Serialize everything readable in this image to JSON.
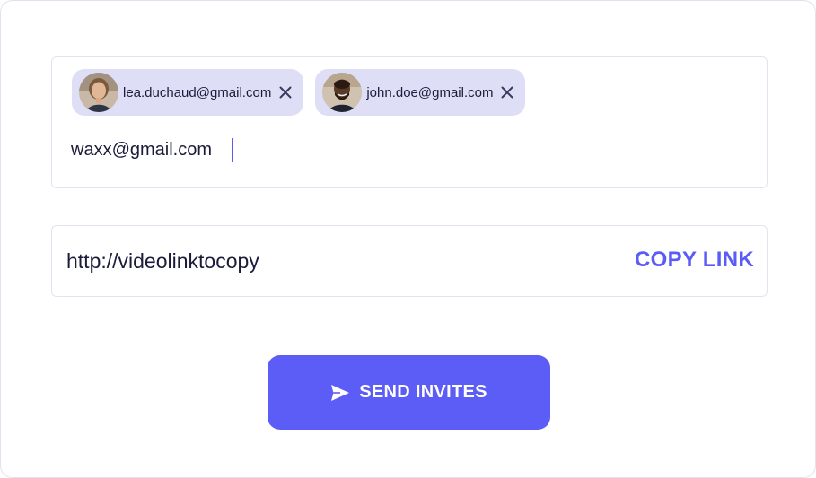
{
  "invite": {
    "recipients": [
      {
        "email": "lea.duchaud@gmail.com",
        "avatar_icon": "avatar-woman"
      },
      {
        "email": "john.doe@gmail.com",
        "avatar_icon": "avatar-man"
      }
    ],
    "input_value": "waxx@gmail.com",
    "remove_icon": "close-icon"
  },
  "share": {
    "link": "http://videolinktocopy",
    "copy_label": "COPY LINK"
  },
  "actions": {
    "send_label": "SEND INVITES",
    "send_icon": "send-icon"
  },
  "colors": {
    "accent": "#5c5cf7",
    "chip_bg": "#dedff6",
    "border": "#e3e3ef",
    "text": "#1c1c3a"
  }
}
